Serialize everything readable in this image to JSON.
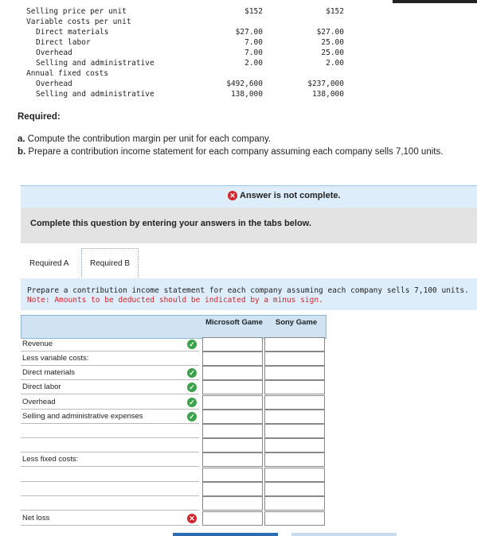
{
  "data_table": {
    "rows": [
      {
        "label": "Selling price per unit",
        "ms": "$152",
        "sony": "$152",
        "indent": 0
      },
      {
        "label": "Variable costs per unit",
        "ms": "",
        "sony": "",
        "indent": 0
      },
      {
        "label": "Direct materials",
        "ms": "$27.00",
        "sony": "$27.00",
        "indent": 1
      },
      {
        "label": "Direct labor",
        "ms": "7.00",
        "sony": "25.00",
        "indent": 1
      },
      {
        "label": "Overhead",
        "ms": "7.00",
        "sony": "25.00",
        "indent": 1
      },
      {
        "label": "Selling and administrative",
        "ms": "2.00",
        "sony": "2.00",
        "indent": 1
      },
      {
        "label": "Annual fixed costs",
        "ms": "",
        "sony": "",
        "indent": 0
      },
      {
        "label": "Overhead",
        "ms": "$492,600",
        "sony": "$237,000",
        "indent": 1
      },
      {
        "label": "Selling and administrative",
        "ms": "138,000",
        "sony": "138,000",
        "indent": 1
      }
    ]
  },
  "required": {
    "heading": "Required:",
    "a_prefix": "a.",
    "a_text": " Compute the contribution margin per unit for each company.",
    "b_prefix": "b.",
    "b_text": " Prepare a contribution income statement for each company assuming each company sells 7,100 units."
  },
  "status": {
    "text": "Answer is not complete.",
    "icon": "x-circle-icon",
    "color": "#d6232b"
  },
  "complete_msg": "Complete this question by entering your answers in the tabs below.",
  "tabs": [
    {
      "label": "Required A",
      "active": false
    },
    {
      "label": "Required B",
      "active": true
    }
  ],
  "instructions": {
    "line1": "Prepare a contribution income statement for each company assuming each company sells 7,100 units.",
    "note": "Note: Amounts to be deducted should be indicated by a minus sign."
  },
  "statement": {
    "col1": "Microsoft Game",
    "col2": "Sony Game",
    "rows": [
      {
        "label": "Revenue",
        "mark": "check"
      },
      {
        "label": "Less variable costs:",
        "mark": ""
      },
      {
        "label": "Direct materials",
        "mark": "check"
      },
      {
        "label": "Direct labor",
        "mark": "check"
      },
      {
        "label": "Overhead",
        "mark": "check"
      },
      {
        "label": "Selling and administrative expenses",
        "mark": "check"
      },
      {
        "label": "",
        "mark": ""
      },
      {
        "label": "",
        "mark": ""
      },
      {
        "label": "Less fixed costs:",
        "mark": ""
      },
      {
        "label": "",
        "mark": ""
      },
      {
        "label": "",
        "mark": ""
      },
      {
        "label": "",
        "mark": ""
      },
      {
        "label": "Net loss",
        "mark": "x"
      }
    ]
  },
  "colors": {
    "accent": "#2d6bb3",
    "check": "#3aa34a",
    "error": "#d6232b",
    "panel": "#ddeefa"
  }
}
